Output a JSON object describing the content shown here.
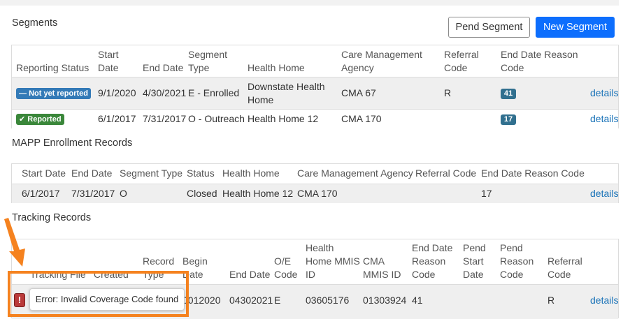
{
  "segments": {
    "heading": "Segments",
    "pend_label": "Pend Segment",
    "new_label": "New Segment",
    "headers": {
      "reporting_status": "Reporting Status",
      "start_1": "Start",
      "start_2": "Date",
      "end_date": "End Date",
      "seg_1": "Segment",
      "seg_2": "Type",
      "health_home": "Health Home",
      "cma_1": "Care Management",
      "cma_2": "Agency",
      "ref_1": "Referral",
      "ref_2": "Code",
      "edr_1": "End Date Reason",
      "edr_2": "Code"
    },
    "rows": [
      {
        "status": "Not yet reported",
        "status_icon": "minus-icon",
        "start": "9/1/2020",
        "end": "4/30/2021",
        "type": "E - Enrolled",
        "hh_1": "Downstate Health",
        "hh_2": "Home",
        "cma": "CMA 67",
        "referral": "R",
        "reason": "41",
        "details": "details"
      },
      {
        "status": "Reported",
        "status_icon": "check-icon",
        "start": "6/1/2017",
        "end": "7/31/2017",
        "type": "O - Outreach",
        "hh_1": "Health Home 12",
        "hh_2": "",
        "cma": "CMA 170",
        "referral": "",
        "reason": "17",
        "details": "details"
      }
    ]
  },
  "mapp": {
    "heading": "MAPP Enrollment Records",
    "headers": [
      "Start Date",
      "End Date",
      "Segment Type",
      "Status",
      "Health Home",
      "Care Management Agency",
      "Referral Code",
      "End Date Reason Code"
    ],
    "row": {
      "start": "6/1/2017",
      "end": "7/31/2017",
      "type": "O",
      "status": "Closed",
      "hh": "Health Home 12",
      "cma": "CMA 170",
      "referral": "",
      "reason": "17",
      "details": "details"
    }
  },
  "tracking": {
    "heading": "Tracking Records",
    "headers": {
      "file": "Tracking File",
      "created": "Created",
      "rec_1": "Record",
      "rec_2": "Type",
      "begin_1": "Begin",
      "begin_2": "Date",
      "end_date": "End Date",
      "oe_1": "O/E",
      "oe_2": "Code",
      "hhm_1": "Health",
      "hhm_2": "Home MMIS",
      "hhm_3": "ID",
      "cma_1": "CMA",
      "cma_2": "MMIS ID",
      "edr_1": "End Date",
      "edr_2": "Reason",
      "edr_3": "Code",
      "ps_1": "Pend",
      "ps_2": "Start",
      "ps_3": "Date",
      "pr_1": "Pend",
      "pr_2": "Reason",
      "pr_3": "Code",
      "ref_1": "Referral",
      "ref_2": "Code"
    },
    "row": {
      "begin": "0012020",
      "end": "04302021",
      "oe": "E",
      "hh_mmis": "03605176",
      "cma_mmis": "01303924",
      "reason": "41",
      "referral": "R",
      "details": "details"
    },
    "error_tooltip": "Error: Invalid Coverage Code found",
    "error_icon_glyph": "!"
  },
  "colors": {
    "primary": "#0d6efd",
    "highlight": "#f5821f",
    "link": "#1a73b8",
    "error": "#b93a3a"
  }
}
